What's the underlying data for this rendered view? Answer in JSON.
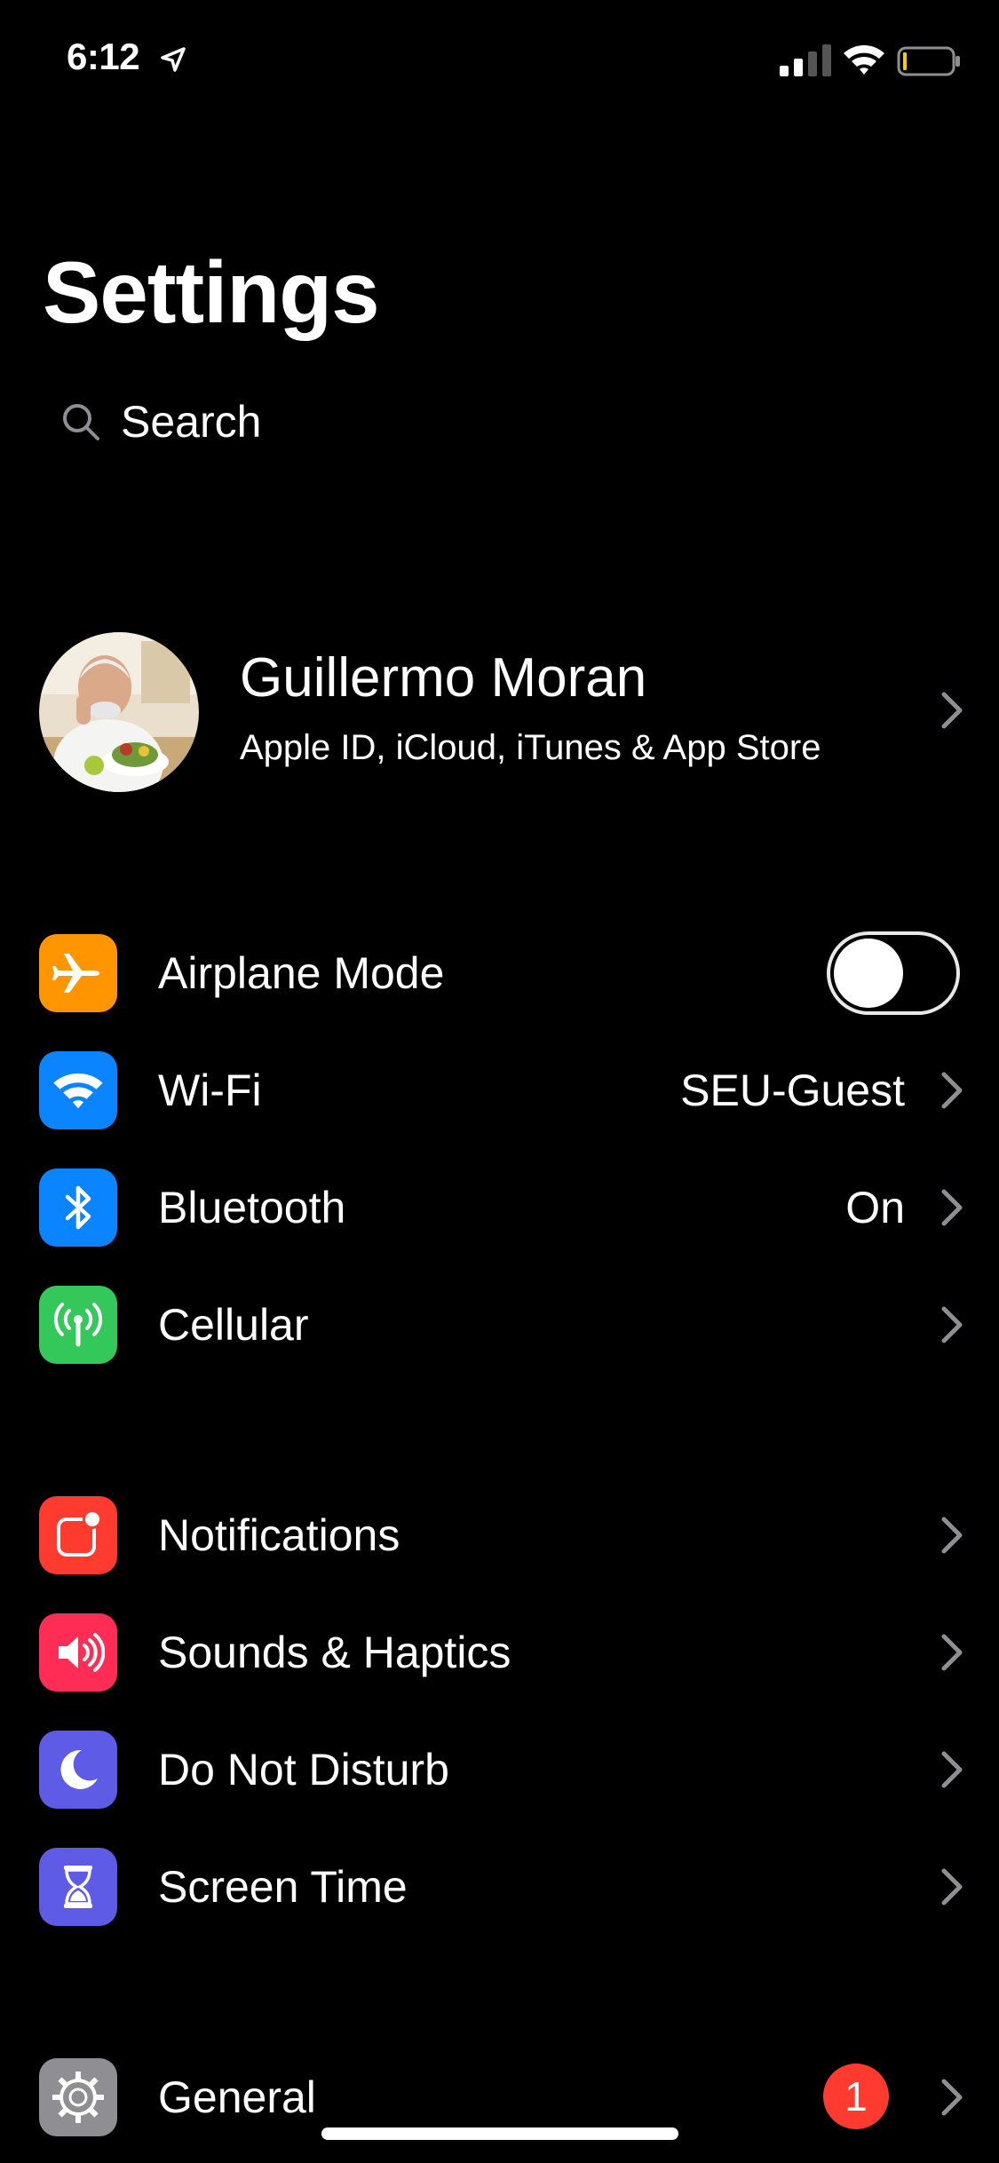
{
  "status_bar": {
    "time": "6:12"
  },
  "header": {
    "title": "Settings"
  },
  "search": {
    "placeholder": "Search"
  },
  "profile": {
    "name": "Guillermo Moran",
    "subtitle": "Apple ID, iCloud, iTunes & App Store"
  },
  "groups": {
    "connectivity": [
      {
        "label": "Airplane Mode",
        "icon": "airplane-icon",
        "color": "#ff9500",
        "toggle": false
      },
      {
        "label": "Wi-Fi",
        "value": "SEU-Guest",
        "icon": "wifi-icon",
        "color": "#0a84ff"
      },
      {
        "label": "Bluetooth",
        "value": "On",
        "icon": "bluetooth-icon",
        "color": "#0a84ff"
      },
      {
        "label": "Cellular",
        "icon": "cellular-icon",
        "color": "#34c759"
      }
    ],
    "alerts": [
      {
        "label": "Notifications",
        "icon": "notifications-icon",
        "color": "#ff3b30"
      },
      {
        "label": "Sounds & Haptics",
        "icon": "speaker-icon",
        "color": "#ff2d55"
      },
      {
        "label": "Do Not Disturb",
        "icon": "moon-icon",
        "color": "#5e5ce6"
      },
      {
        "label": "Screen Time",
        "icon": "hourglass-icon",
        "color": "#5e5ce6"
      }
    ],
    "system": [
      {
        "label": "General",
        "icon": "gear-icon",
        "color": "#8e8e93",
        "badge": "1"
      }
    ]
  }
}
